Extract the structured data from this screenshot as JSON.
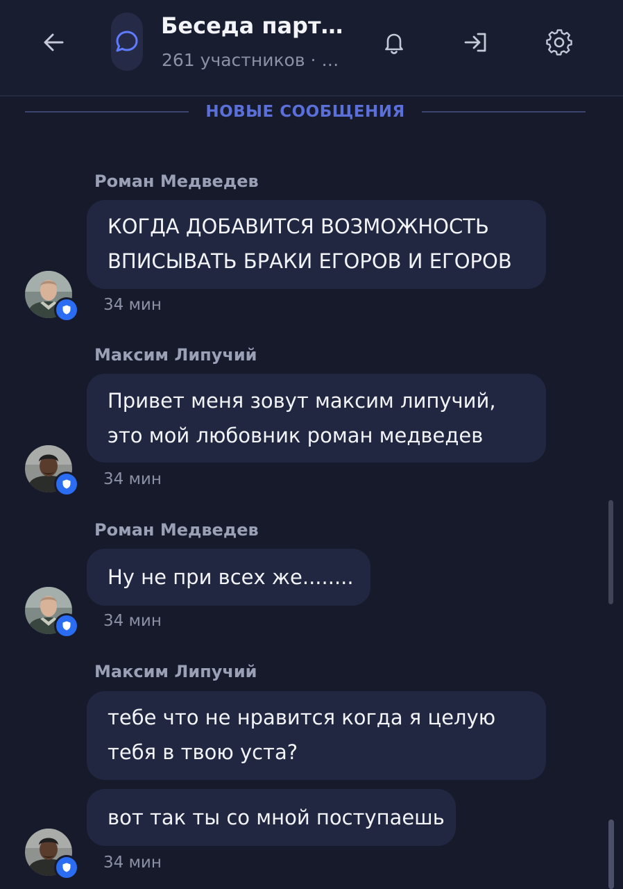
{
  "header": {
    "back_icon": "arrow-left-icon",
    "channel_icon": "chat-bubble-icon",
    "title": "Беседа парт…",
    "subtitle": "261 участников · …",
    "actions": [
      "bell-icon",
      "sign-in-icon",
      "gear-icon"
    ]
  },
  "divider": {
    "label": "НОВЫЕ СООБЩЕНИЯ"
  },
  "messages": [
    {
      "sender": "Роман Медведев",
      "lines": [
        "КОГДА ДОБАВИТСЯ ВОЗМОЖНОСТЬ",
        "ВПИСЫВАТЬ БРАКИ ЕГОРОВ И ЕГОРОВ"
      ],
      "time": "34 мин"
    },
    {
      "sender": "Максим Липучий",
      "lines": [
        "Привет меня зовут максим липучий,",
        "это мой любовник роман медведев"
      ],
      "time": "34 мин"
    },
    {
      "sender": "Роман Медведев",
      "lines": [
        "Ну не при всех же........"
      ],
      "time": "34 мин"
    },
    {
      "sender": "Максим Липучий",
      "bubbles": [
        {
          "lines": [
            "тебе что не нравится когда я целую",
            "тебя в твою уста?"
          ]
        },
        {
          "lines": [
            "вот так ты со мной поступаешь"
          ]
        }
      ],
      "time": "34 мин"
    }
  ],
  "colors": {
    "background": "#171a2b",
    "bubble": "#222741",
    "accent": "#5a6fd8",
    "badge": "#2a6df2"
  }
}
